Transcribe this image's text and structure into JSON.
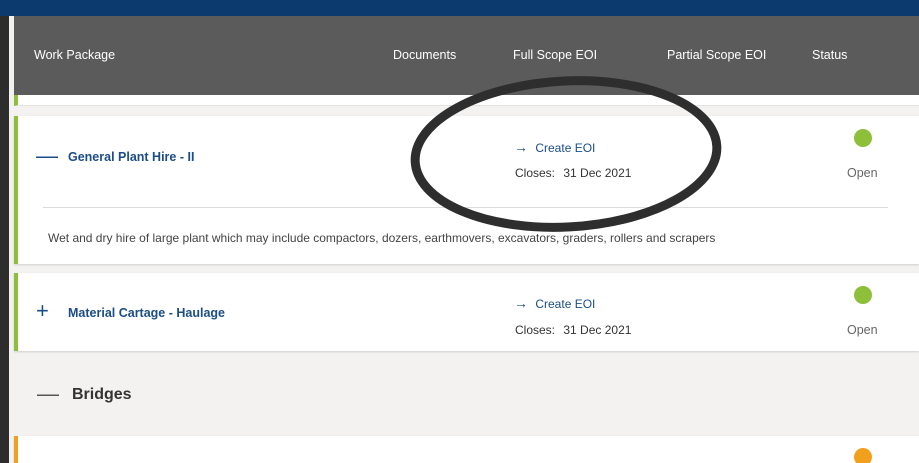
{
  "table": {
    "columns": {
      "work_package": "Work Package",
      "documents": "Documents",
      "full_scope": "Full Scope EOI",
      "partial_scope": "Partial Scope EOI",
      "status": "Status"
    }
  },
  "packages": [
    {
      "toggle": "—",
      "title": "General Plant Hire - II",
      "link_arrow": "→",
      "link_label": "Create EOI",
      "closes_label": "Closes:",
      "closes_date": "31 Dec 2021",
      "status": "Open",
      "status_color": "#8dbf3b",
      "description": "Wet and dry hire of large plant which may include compactors, dozers, earthmovers, excavators, graders, rollers and scrapers"
    },
    {
      "toggle": "+",
      "title": "Material Cartage - Haulage",
      "link_arrow": "→",
      "link_label": "Create EOI",
      "closes_label": "Closes:",
      "closes_date": "31 Dec 2021",
      "status": "Open",
      "status_color": "#8dbf3b"
    }
  ],
  "section": {
    "toggle": "—",
    "title": "Bridges"
  },
  "next_card": {
    "status_color": "#f1a01e"
  }
}
